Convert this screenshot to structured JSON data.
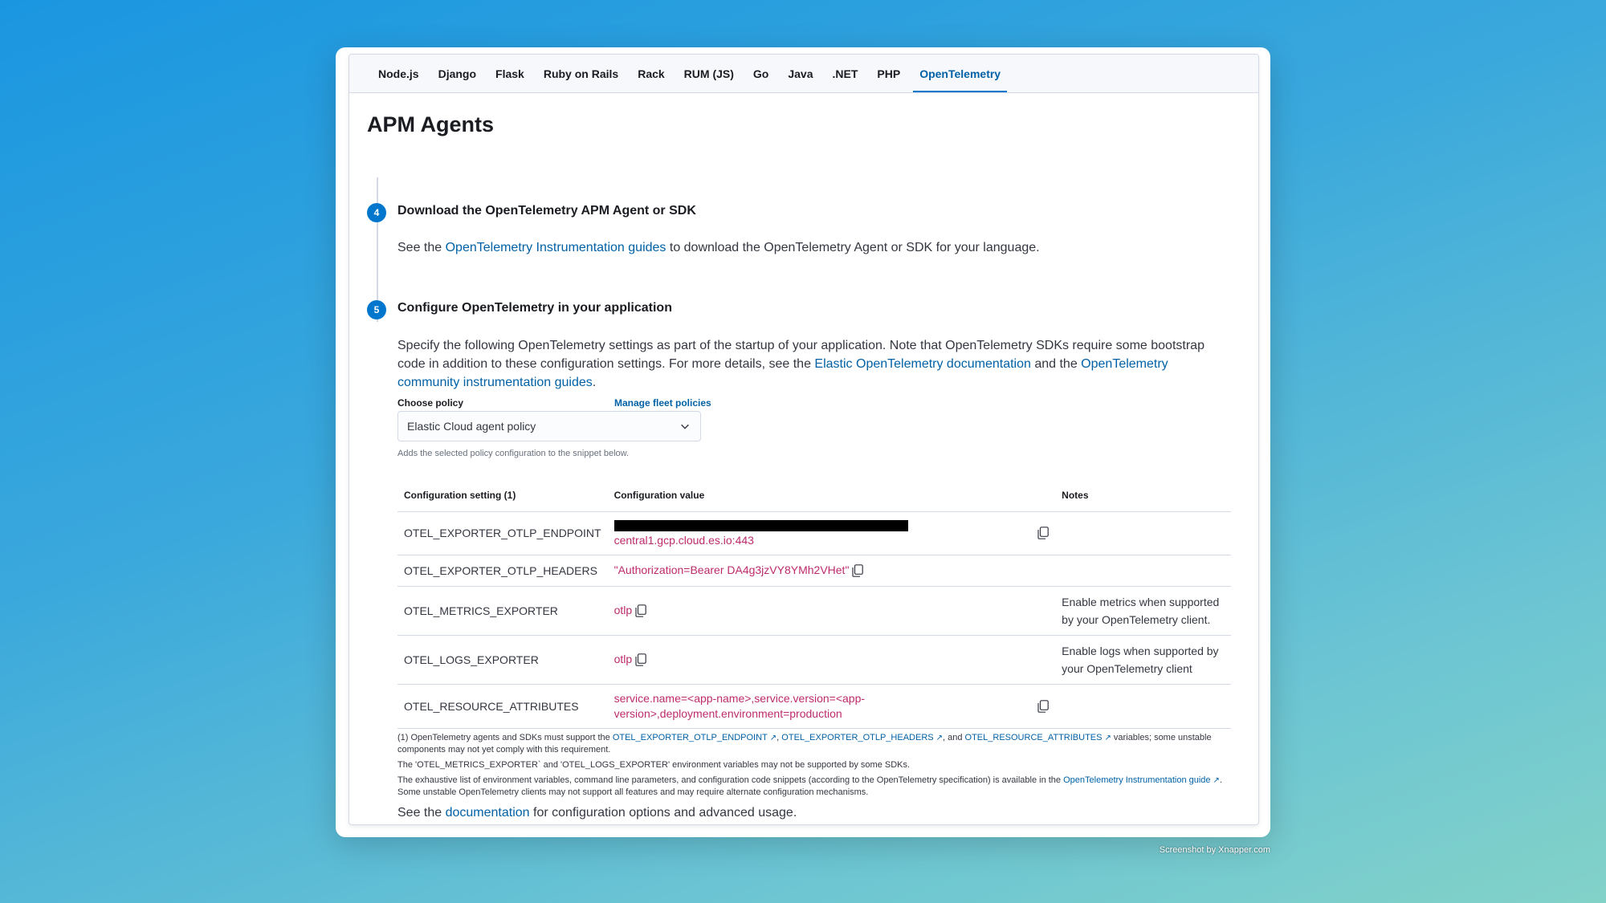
{
  "tabs": [
    "Node.js",
    "Django",
    "Flask",
    "Ruby on Rails",
    "Rack",
    "RUM (JS)",
    "Go",
    "Java",
    ".NET",
    "PHP",
    "OpenTelemetry"
  ],
  "active_tab": "OpenTelemetry",
  "page_title": "APM Agents",
  "step4": {
    "number": "4",
    "title": "Download the OpenTelemetry APM Agent or SDK",
    "text_before": "See the ",
    "link": "OpenTelemetry Instrumentation guides",
    "text_after": " to download the OpenTelemetry Agent or SDK for your language."
  },
  "step5": {
    "number": "5",
    "title": "Configure OpenTelemetry in your application",
    "text_1": "Specify the following OpenTelemetry settings as part of the startup of your application. Note that OpenTelemetry SDKs require some bootstrap code in addition to these configuration settings. For more details, see the ",
    "link_1": "Elastic OpenTelemetry documentation",
    "text_2": " and the ",
    "link_2": "OpenTelemetry community instrumentation guides",
    "text_3": "."
  },
  "policy": {
    "label": "Choose policy",
    "manage_link": "Manage fleet policies",
    "selected": "Elastic Cloud agent policy",
    "help": "Adds the selected policy configuration to the snippet below."
  },
  "table": {
    "headers": [
      "Configuration setting (1)",
      "Configuration value",
      "Notes"
    ],
    "rows": [
      {
        "setting": "OTEL_EXPORTER_OTLP_ENDPOINT",
        "value": "central1.gcp.cloud.es.io:443",
        "notes": ""
      },
      {
        "setting": "OTEL_EXPORTER_OTLP_HEADERS",
        "value": "\"Authorization=Bearer DA4g3jzVY8YMh2VHet\"",
        "notes": ""
      },
      {
        "setting": "OTEL_METRICS_EXPORTER",
        "value": "otlp",
        "notes": "Enable metrics when supported by your OpenTelemetry client."
      },
      {
        "setting": "OTEL_LOGS_EXPORTER",
        "value": "otlp",
        "notes": "Enable logs when supported by your OpenTelemetry client"
      },
      {
        "setting": "OTEL_RESOURCE_ATTRIBUTES",
        "value": "service.name=<app-name>,service.version=<app-version>,deployment.environment=production",
        "notes": ""
      }
    ]
  },
  "footnotes": {
    "f1_a": "(1) OpenTelemetry agents and SDKs must support the ",
    "f1_link1": "OTEL_EXPORTER_OTLP_ENDPOINT",
    "f1_b": ", ",
    "f1_link2": "OTEL_EXPORTER_OTLP_HEADERS",
    "f1_c": ", and ",
    "f1_link3": "OTEL_RESOURCE_ATTRIBUTES",
    "f1_d": " variables; some unstable components may not yet comply with this requirement.",
    "f2": "The 'OTEL_METRICS_EXPORTER` and 'OTEL_LOGS_EXPORTER' environment variables may not be supported by some SDKs.",
    "f3_a": "The exhaustive list of environment variables, command line parameters, and configuration code snippets (according to the OpenTelemetry specification) is available in the ",
    "f3_link": "OpenTelemetry Instrumentation guide",
    "f3_b": ". Some unstable OpenTelemetry clients may not support all features and may require alternate configuration mechanisms."
  },
  "see_doc": {
    "before": "See the ",
    "link": "documentation",
    "after": " for configuration options and advanced usage."
  },
  "credit": "Screenshot by Xnapper.com",
  "colors": {
    "link": "#0061a6",
    "code": "#bd2b6c",
    "step_badge": "#0077cc"
  },
  "icons": {
    "copy": "copy-clipboard-icon",
    "chevron": "chevron-down-icon",
    "external": "external-link-icon"
  }
}
